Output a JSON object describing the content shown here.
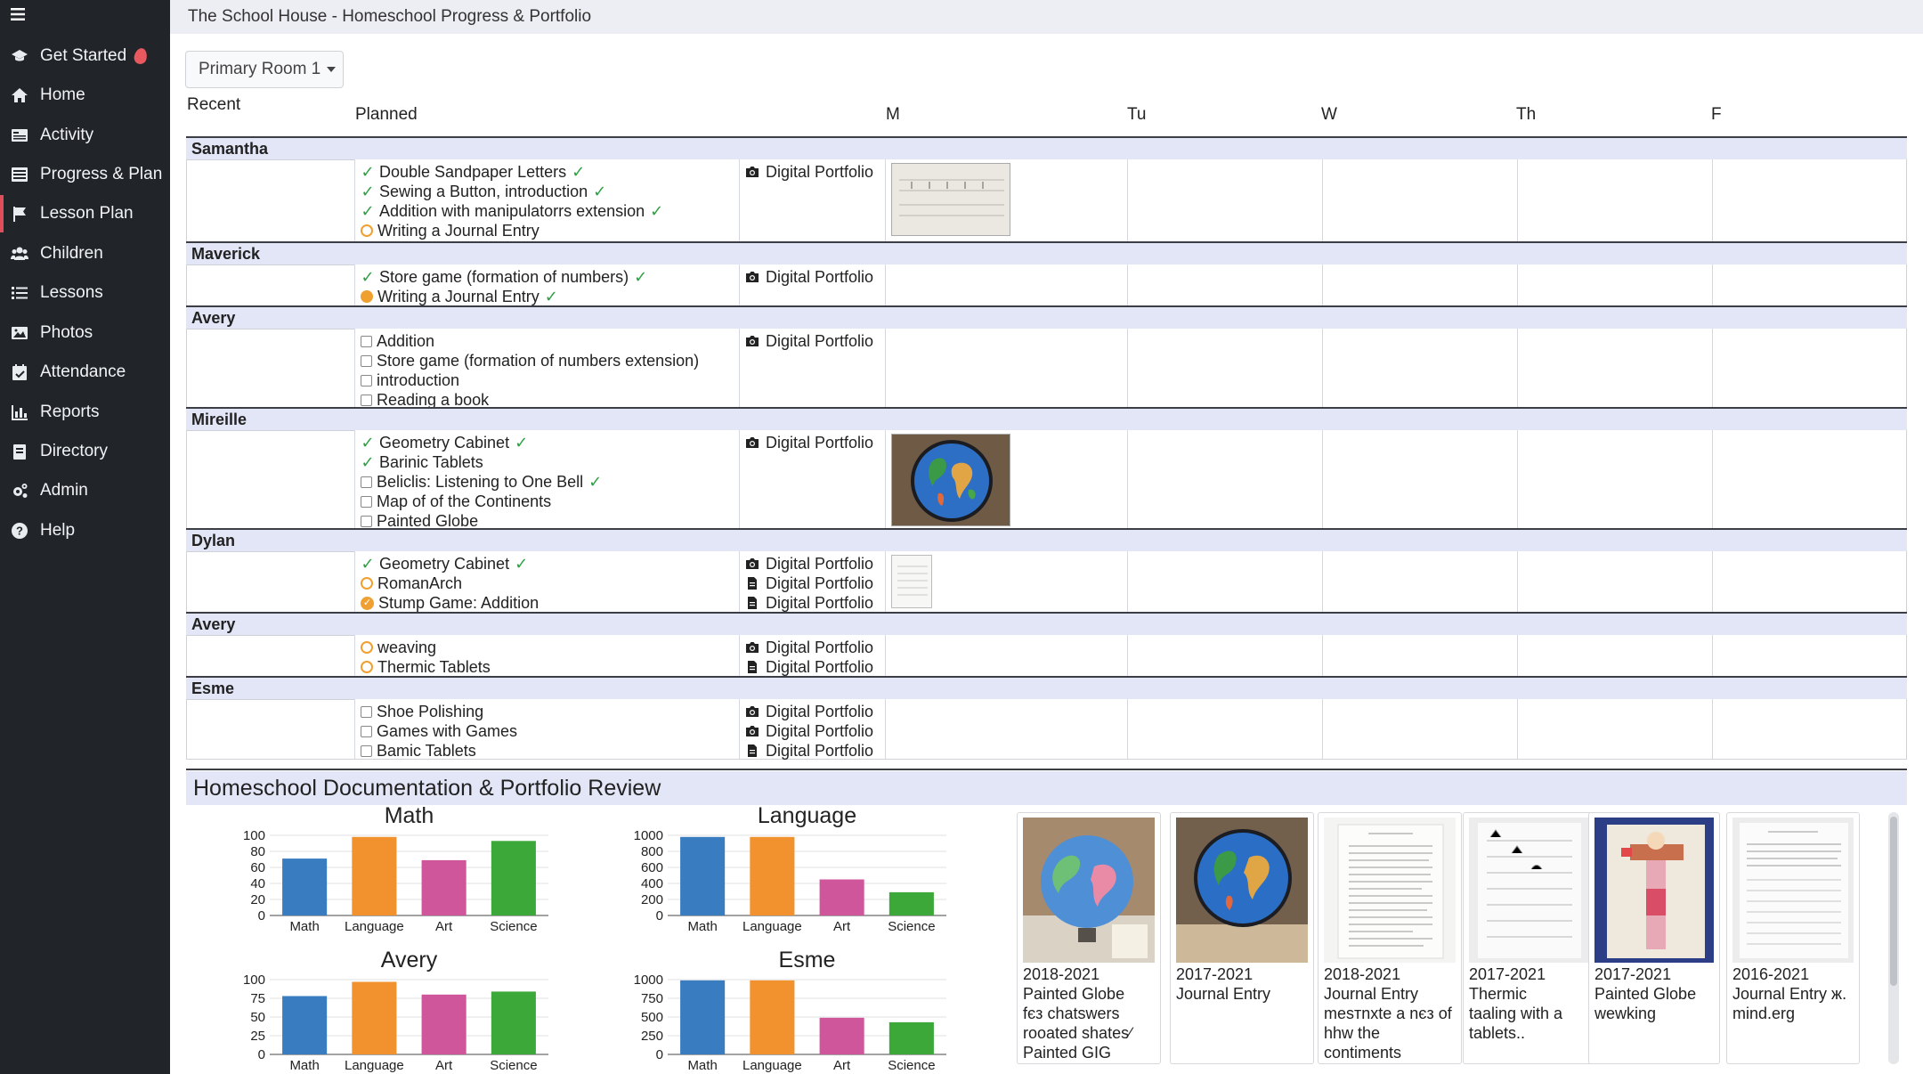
{
  "app": {
    "title": "The School House - Homeschool Progress & Portfolio"
  },
  "sidebar": {
    "items": [
      {
        "label": "Get Started",
        "icon": "graduation-cap-icon"
      },
      {
        "label": "Home",
        "icon": "home-icon"
      },
      {
        "label": "Activity",
        "icon": "activity-icon"
      },
      {
        "label": "Progress & Plan",
        "icon": "progress-icon"
      },
      {
        "label": "Lesson Plan",
        "icon": "flag-icon"
      },
      {
        "label": "Children",
        "icon": "users-icon"
      },
      {
        "label": "Lessons",
        "icon": "list-icon"
      },
      {
        "label": "Photos",
        "icon": "image-icon"
      },
      {
        "label": "Attendance",
        "icon": "calendar-check-icon"
      },
      {
        "label": "Reports",
        "icon": "bar-chart-icon"
      },
      {
        "label": "Directory",
        "icon": "book-icon"
      },
      {
        "label": "Admin",
        "icon": "cogs-icon"
      },
      {
        "label": "Help",
        "icon": "question-circle-icon"
      }
    ],
    "active": "Lesson Plan"
  },
  "room_select": {
    "value": "Primary Room 1"
  },
  "columns": {
    "recent": "Recent",
    "planned": "Planned",
    "m": "M",
    "tu": "Tu",
    "w": "W",
    "th": "Th",
    "f": "F"
  },
  "students": [
    {
      "name": "Samantha",
      "lessons": [
        {
          "text": "Double Sandpaper Letters",
          "status": "check",
          "tail_check": true
        },
        {
          "text": "Sewing a Button, introduction",
          "status": "check",
          "tail_check": true
        },
        {
          "text": "Addition with manipulatorrs extension",
          "status": "check",
          "tail_check": true
        },
        {
          "text": "Writing a Journal Entry",
          "status": "open",
          "tail_check": false
        }
      ],
      "portfolio": [
        "Digital Portfolio"
      ]
    },
    {
      "name": "Maverick",
      "lessons": [
        {
          "text": "Store game (formation of numbers)",
          "status": "check",
          "tail_check": true
        },
        {
          "text": "Writing a Journal Entry",
          "status": "full",
          "tail_check": true
        }
      ],
      "portfolio": [
        "Digital Portfolio"
      ]
    },
    {
      "name": "Avery",
      "lessons": [
        {
          "text": "Addition",
          "status": "box",
          "tail_check": false
        },
        {
          "text": "Store game (formation of numbers extension)",
          "status": "box",
          "tail_check": false
        },
        {
          "text": "introduction",
          "status": "box",
          "tail_check": false
        },
        {
          "text": "Reading a book",
          "status": "box",
          "tail_check": false
        }
      ],
      "portfolio": [
        "Digital Portfolio"
      ]
    },
    {
      "name": "Mireille",
      "lessons": [
        {
          "text": "Geometry Cabinet",
          "status": "check",
          "tail_check": true
        },
        {
          "text": "Barinic Tablets",
          "status": "check",
          "tail_check": false
        },
        {
          "text": "Beliclis: Listening to One Bell",
          "status": "box",
          "tail_check": true
        },
        {
          "text": "Map of of the Continents",
          "status": "box",
          "tail_check": false
        },
        {
          "text": "Painted Globe",
          "status": "box",
          "tail_check": false
        }
      ],
      "portfolio": [
        "Digital Portfolio"
      ]
    },
    {
      "name": "Dylan",
      "lessons": [
        {
          "text": "Geometry Cabinet",
          "status": "check",
          "tail_check": true
        },
        {
          "text": "RomanArch",
          "status": "open",
          "tail_check": false
        },
        {
          "text": "Stump Game: Addition",
          "status": "full-check",
          "tail_check": false
        }
      ],
      "portfolio": [
        "Digital Portfolio",
        "Digital Portfolio",
        "Digital Portfolio"
      ]
    },
    {
      "name": "Avery",
      "lessons": [
        {
          "text": "weaving",
          "status": "open",
          "tail_check": false
        },
        {
          "text": "Thermic Tablets",
          "status": "open",
          "tail_check": false
        }
      ],
      "portfolio": [
        "Digital Portfolio",
        "Digital Portfolio"
      ]
    },
    {
      "name": "Esme",
      "lessons": [
        {
          "text": "Shoe Polishing",
          "status": "box",
          "tail_check": false
        },
        {
          "text": "Games with Games",
          "status": "box",
          "tail_check": false
        },
        {
          "text": "Bamic Tablets",
          "status": "box",
          "tail_check": false
        }
      ],
      "portfolio": [
        "Digital Portfolio",
        "Digital Portfolio",
        "Digital Portfolio"
      ]
    }
  ],
  "doc_panel": {
    "title": "Homeschool Documentation & Portfolio Review"
  },
  "colors": {
    "math": "#3a7cc0",
    "language": "#f2922e",
    "art": "#d0569b",
    "science": "#3da83a"
  },
  "chart_data": [
    {
      "type": "bar",
      "title": "Math",
      "categories": [
        "Math",
        "Language",
        "Art",
        "Science"
      ],
      "values": [
        71,
        98,
        69,
        93
      ],
      "ylim": [
        0,
        100
      ],
      "yticks": [
        0,
        20,
        40,
        60,
        80,
        100
      ]
    },
    {
      "type": "bar",
      "title": "Language",
      "categories": [
        "Math",
        "Language",
        "Art",
        "Science"
      ],
      "values": [
        980,
        980,
        450,
        290
      ],
      "ylim": [
        0,
        1000
      ],
      "yticks": [
        0,
        200,
        400,
        600,
        800,
        1000
      ]
    },
    {
      "type": "bar",
      "title": "Avery",
      "categories": [
        "Math",
        "Language",
        "Art",
        "Science"
      ],
      "values": [
        78,
        97,
        80,
        84
      ],
      "ylim": [
        0,
        100
      ],
      "yticks": [
        0,
        25,
        50,
        75,
        100
      ]
    },
    {
      "type": "bar",
      "title": "Esme",
      "categories": [
        "Math",
        "Language",
        "Art",
        "Science"
      ],
      "values": [
        990,
        990,
        490,
        430
      ],
      "ylim": [
        0,
        1000
      ],
      "yticks": [
        0,
        250,
        500,
        750,
        1000
      ]
    }
  ],
  "cards": [
    {
      "caption": "2018-2021\nPainted Globe\nfєз chatswers\nrooated shates∕\nPainted GIG"
    },
    {
      "caption": "2017-2021\nJournal Entry"
    },
    {
      "caption": "2018-2021\nJournal Entry\nmesтnxte a nєз of\nhhw the\ncontiments"
    },
    {
      "caption": "2017-2021\nThermic\ntaaling with a\ntablets.."
    },
    {
      "caption": "2017-2021\nPainted Globe\nwewking"
    },
    {
      "caption": "2016-2021\nJournal Entry ж.\nmind.erg"
    }
  ]
}
